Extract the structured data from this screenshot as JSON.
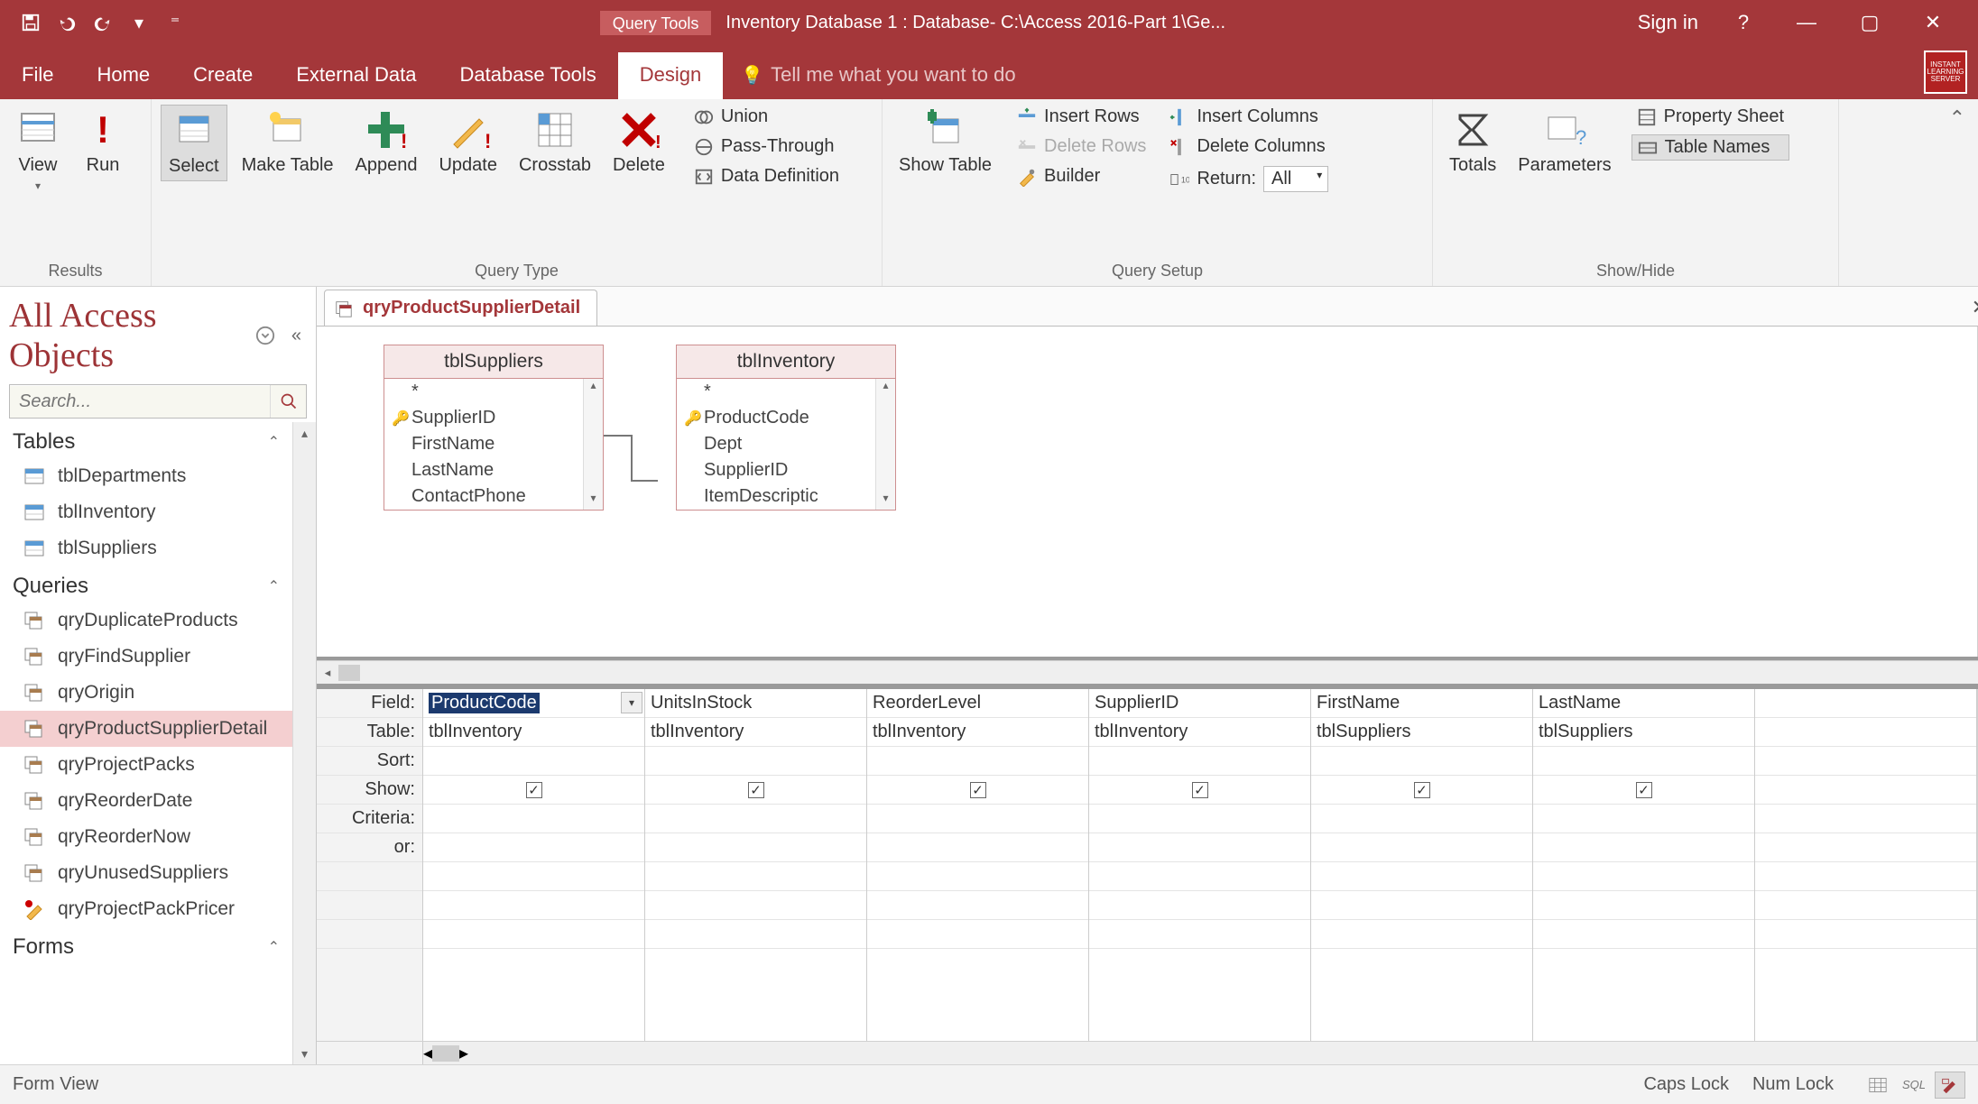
{
  "titlebar": {
    "tool_tab": "Query Tools",
    "title": "Inventory Database 1 : Database- C:\\Access 2016-Part 1\\Ge...",
    "signin": "Sign in"
  },
  "tabs": {
    "file": "File",
    "home": "Home",
    "create": "Create",
    "external": "External Data",
    "dbtools": "Database Tools",
    "design": "Design",
    "tellme": "Tell me what you want to do"
  },
  "ribbon": {
    "results": {
      "view": "View",
      "run": "Run",
      "label": "Results"
    },
    "querytype": {
      "select": "Select",
      "maketable": "Make Table",
      "append": "Append",
      "update": "Update",
      "crosstab": "Crosstab",
      "delete": "Delete",
      "union": "Union",
      "passthrough": "Pass-Through",
      "datadef": "Data Definition",
      "label": "Query Type"
    },
    "querysetup": {
      "showtable": "Show Table",
      "insertrows": "Insert Rows",
      "deleterows": "Delete Rows",
      "builder": "Builder",
      "insertcols": "Insert Columns",
      "deletecols": "Delete Columns",
      "return": "Return:",
      "return_val": "All",
      "label": "Query Setup"
    },
    "showhide": {
      "totals": "Totals",
      "parameters": "Parameters",
      "propsheet": "Property Sheet",
      "tablenames": "Table Names",
      "label": "Show/Hide"
    }
  },
  "nav": {
    "title": "All Access Objects",
    "search_ph": "Search...",
    "groups": {
      "tables": "Tables",
      "queries": "Queries",
      "forms": "Forms"
    },
    "tables": [
      "tblDepartments",
      "tblInventory",
      "tblSuppliers"
    ],
    "queries": [
      "qryDuplicateProducts",
      "qryFindSupplier",
      "qryOrigin",
      "qryProductSupplierDetail",
      "qryProjectPacks",
      "qryReorderDate",
      "qryReorderNow",
      "qryUnusedSuppliers",
      "qryProjectPackPricer"
    ],
    "selected": "qryProductSupplierDetail"
  },
  "design": {
    "tab_name": "qryProductSupplierDetail",
    "tables": {
      "suppliers": {
        "title": "tblSuppliers",
        "fields": [
          "*",
          "SupplierID",
          "FirstName",
          "LastName",
          "ContactPhone"
        ],
        "pk_index": 1
      },
      "inventory": {
        "title": "tblInventory",
        "fields": [
          "*",
          "ProductCode",
          "Dept",
          "SupplierID",
          "ItemDescriptic"
        ],
        "pk_index": 1
      }
    }
  },
  "qbe": {
    "labels": {
      "field": "Field:",
      "table": "Table:",
      "sort": "Sort:",
      "show": "Show:",
      "criteria": "Criteria:",
      "or": "or:"
    },
    "cols": [
      {
        "field": "ProductCode",
        "table": "tblInventory",
        "show": true,
        "selected": true
      },
      {
        "field": "UnitsInStock",
        "table": "tblInventory",
        "show": true
      },
      {
        "field": "ReorderLevel",
        "table": "tblInventory",
        "show": true
      },
      {
        "field": "SupplierID",
        "table": "tblInventory",
        "show": true
      },
      {
        "field": "FirstName",
        "table": "tblSuppliers",
        "show": true
      },
      {
        "field": "LastName",
        "table": "tblSuppliers",
        "show": true
      }
    ]
  },
  "status": {
    "left": "Form View",
    "caps": "Caps Lock",
    "num": "Num Lock"
  }
}
